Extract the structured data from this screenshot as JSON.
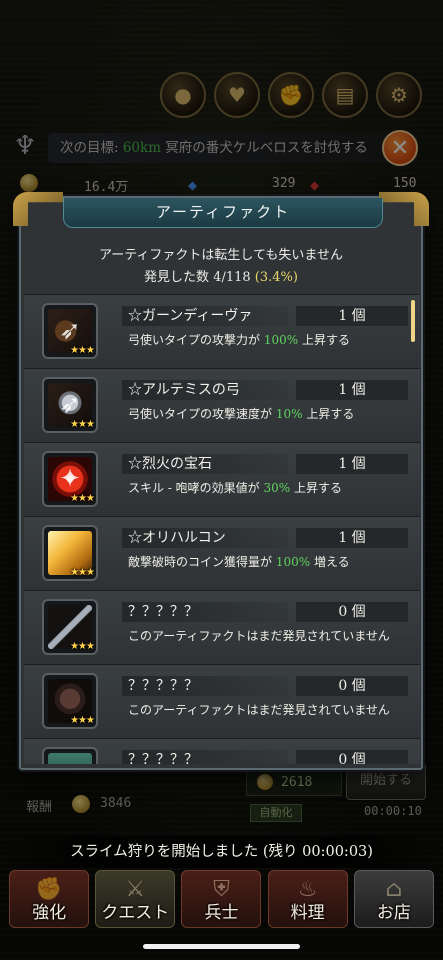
{
  "top_icons": [
    "medal-icon",
    "potion-icon",
    "fist-icon",
    "spellbook-icon",
    "gear-icon"
  ],
  "goal": {
    "prefix": "次の目標: ",
    "distance": "60km",
    "text": " 冥府の番犬ケルベロスを討伐する"
  },
  "currency": {
    "gold": "16.4万",
    "gems": "329",
    "rubies": "150"
  },
  "modal": {
    "title": "アーティファクト",
    "subtitle": "アーティファクトは転生しても失いません",
    "found_label": "発見した数 ",
    "found_value": "4/118",
    "found_pct": "(3.4%)"
  },
  "artifacts": [
    {
      "name": "☆ガーンディーヴァ",
      "count": "1 個",
      "desc_a": "弓使いタイプの攻撃力が ",
      "highlight": "100%",
      "desc_b": " 上昇する",
      "stars": "★★★",
      "icon": "bow-icon"
    },
    {
      "name": "☆アルテミスの弓",
      "count": "1 個",
      "desc_a": "弓使いタイプの攻撃速度が ",
      "highlight": "10%",
      "desc_b": " 上昇する",
      "stars": "★★★",
      "icon": "silver-bow-icon"
    },
    {
      "name": "☆烈火の宝石",
      "count": "1 個",
      "desc_a": "スキル - 咆哮の効果値が ",
      "highlight": "30%",
      "desc_b": " 上昇する",
      "stars": "★★★",
      "icon": "fire-gem-icon"
    },
    {
      "name": "☆オリハルコン",
      "count": "1 個",
      "desc_a": "敵撃破時のコイン獲得量が ",
      "highlight": "100%",
      "desc_b": "  増える",
      "stars": "★★★",
      "icon": "crystal-icon"
    },
    {
      "name": "？？？？？",
      "count": "0 個",
      "desc_a": "このアーティファクトはまだ発見されていません",
      "highlight": "",
      "desc_b": "",
      "stars": "★★★",
      "icon": "dagger-icon"
    },
    {
      "name": "？？？？？",
      "count": "0 個",
      "desc_a": "このアーティファクトはまだ発見されていません",
      "highlight": "",
      "desc_b": "",
      "stars": "★★★",
      "icon": "armor-icon"
    },
    {
      "name": "？？？？？",
      "count": "0 個",
      "desc_a": "",
      "highlight": "",
      "desc_b": "",
      "stars": "",
      "icon": "scroll-icon"
    }
  ],
  "behind": {
    "reward_value": "2618",
    "dispatch_label": "開始する",
    "auto_label": "自動化",
    "timer": "00:00:10",
    "reward_label": "報酬",
    "reward_total": "3846"
  },
  "toast": "スライム狩りを開始しました (残り 00:00:03)",
  "nav": [
    "強化",
    "クエスト",
    "兵士",
    "料理",
    "お店"
  ]
}
